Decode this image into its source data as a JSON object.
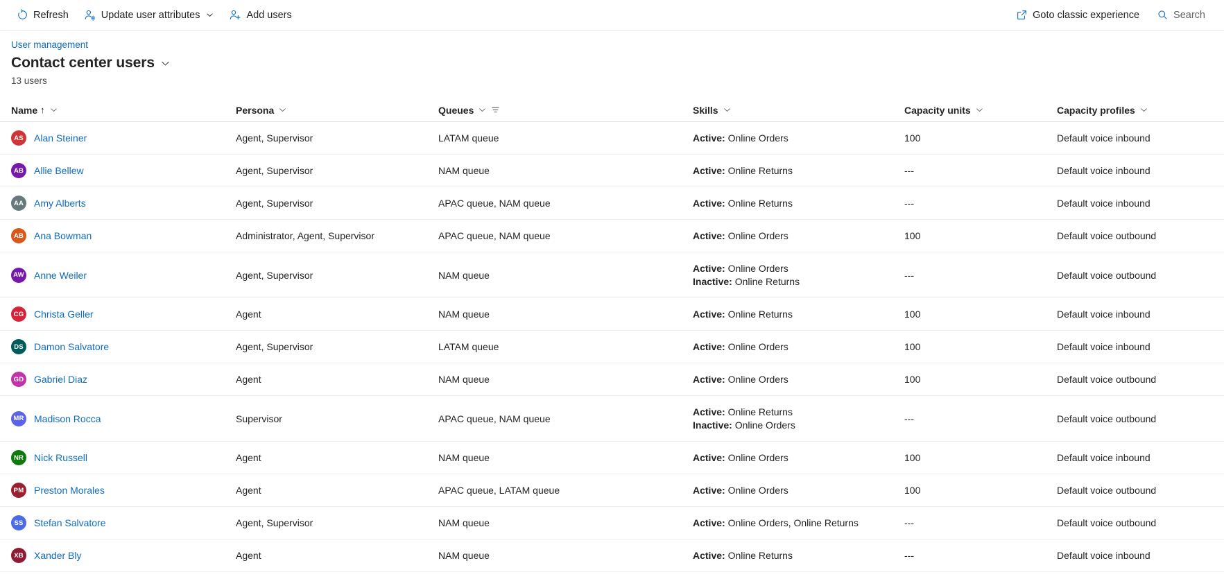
{
  "commandbar": {
    "left_buttons": [
      {
        "label": "Refresh",
        "icon": "refresh-icon"
      },
      {
        "label": "Update user attributes",
        "icon": "user-settings-icon",
        "has_chevron": true
      },
      {
        "label": "Add users",
        "icon": "user-add-icon"
      }
    ],
    "right_buttons": [
      {
        "label": "Goto classic experience",
        "icon": "open-external-icon"
      },
      {
        "label": "Search",
        "icon": "search-icon"
      }
    ]
  },
  "header": {
    "breadcrumb": "User management",
    "title": "Contact center users",
    "count": "13 users"
  },
  "table": {
    "columns": [
      {
        "label": "Name",
        "sort": "↑",
        "chevron": true,
        "filter": false
      },
      {
        "label": "Persona",
        "sort": "",
        "chevron": true,
        "filter": false
      },
      {
        "label": "Queues",
        "sort": "",
        "chevron": true,
        "filter": true
      },
      {
        "label": "Skills",
        "sort": "",
        "chevron": true,
        "filter": false
      },
      {
        "label": "Capacity units",
        "sort": "",
        "chevron": true,
        "filter": false
      },
      {
        "label": "Capacity profiles",
        "sort": "",
        "chevron": true,
        "filter": false
      }
    ],
    "rows": [
      {
        "initials": "AS",
        "color": "#d13438",
        "name": "Alan Steiner",
        "persona": "Agent, Supervisor",
        "queues": "LATAM queue",
        "skills": [
          {
            "state": "Active:",
            "value": "Online Orders"
          }
        ],
        "capacity_units": "100",
        "capacity_profile": "Default voice inbound"
      },
      {
        "initials": "AB",
        "color": "#7719aa",
        "name": "Allie Bellew",
        "persona": "Agent, Supervisor",
        "queues": "NAM queue",
        "skills": [
          {
            "state": "Active:",
            "value": "Online Returns"
          }
        ],
        "capacity_units": "---",
        "capacity_profile": "Default voice inbound"
      },
      {
        "initials": "AA",
        "color": "#68797d",
        "name": "Amy Alberts",
        "persona": "Agent, Supervisor",
        "queues": "APAC queue, NAM queue",
        "skills": [
          {
            "state": "Active:",
            "value": "Online Returns"
          }
        ],
        "capacity_units": "---",
        "capacity_profile": "Default voice inbound"
      },
      {
        "initials": "AB",
        "color": "#d9591b",
        "name": "Ana Bowman",
        "persona": "Administrator, Agent, Supervisor",
        "queues": "APAC queue, NAM queue",
        "skills": [
          {
            "state": "Active:",
            "value": "Online Orders"
          }
        ],
        "capacity_units": "100",
        "capacity_profile": "Default voice outbound"
      },
      {
        "initials": "AW",
        "color": "#7719aa",
        "name": "Anne Weiler",
        "persona": "Agent, Supervisor",
        "queues": "NAM queue",
        "skills": [
          {
            "state": "Active:",
            "value": "Online Orders"
          },
          {
            "state": "Inactive:",
            "value": "Online Returns"
          }
        ],
        "capacity_units": "---",
        "capacity_profile": "Default voice outbound"
      },
      {
        "initials": "CG",
        "color": "#d6243b",
        "name": "Christa Geller",
        "persona": "Agent",
        "queues": "NAM queue",
        "skills": [
          {
            "state": "Active:",
            "value": "Online Returns"
          }
        ],
        "capacity_units": "100",
        "capacity_profile": "Default voice inbound"
      },
      {
        "initials": "DS",
        "color": "#005b5b",
        "name": "Damon Salvatore",
        "persona": "Agent, Supervisor",
        "queues": "LATAM queue",
        "skills": [
          {
            "state": "Active:",
            "value": "Online Orders"
          }
        ],
        "capacity_units": "100",
        "capacity_profile": "Default voice inbound"
      },
      {
        "initials": "GD",
        "color": "#c333a8",
        "name": "Gabriel Diaz",
        "persona": "Agent",
        "queues": "NAM queue",
        "skills": [
          {
            "state": "Active:",
            "value": "Online Orders"
          }
        ],
        "capacity_units": "100",
        "capacity_profile": "Default voice outbound"
      },
      {
        "initials": "MR",
        "color": "#5b63e8",
        "name": "Madison Rocca",
        "persona": "Supervisor",
        "queues": "APAC queue, NAM queue",
        "skills": [
          {
            "state": "Active:",
            "value": "Online Returns"
          },
          {
            "state": "Inactive:",
            "value": "Online Orders"
          }
        ],
        "capacity_units": "---",
        "capacity_profile": "Default voice outbound"
      },
      {
        "initials": "NR",
        "color": "#0e7a0b",
        "name": "Nick Russell",
        "persona": "Agent",
        "queues": "NAM queue",
        "skills": [
          {
            "state": "Active:",
            "value": "Online Orders"
          }
        ],
        "capacity_units": "100",
        "capacity_profile": "Default voice inbound"
      },
      {
        "initials": "PM",
        "color": "#9c1f30",
        "name": "Preston Morales",
        "persona": "Agent",
        "queues": "APAC queue, LATAM queue",
        "skills": [
          {
            "state": "Active:",
            "value": "Online Orders"
          }
        ],
        "capacity_units": "100",
        "capacity_profile": "Default voice outbound"
      },
      {
        "initials": "SS",
        "color": "#4b6ae8",
        "name": "Stefan Salvatore",
        "persona": "Agent, Supervisor",
        "queues": "NAM queue",
        "skills": [
          {
            "state": "Active:",
            "value": "Online Orders, Online Returns"
          }
        ],
        "capacity_units": "---",
        "capacity_profile": "Default voice outbound"
      },
      {
        "initials": "XB",
        "color": "#8e1b33",
        "name": "Xander Bly",
        "persona": "Agent",
        "queues": "NAM queue",
        "skills": [
          {
            "state": "Active:",
            "value": "Online Returns"
          }
        ],
        "capacity_units": "---",
        "capacity_profile": "Default voice inbound"
      }
    ]
  },
  "colors": {
    "accent": "#0f6cbd",
    "text": "#242424",
    "muted": "#616161"
  }
}
